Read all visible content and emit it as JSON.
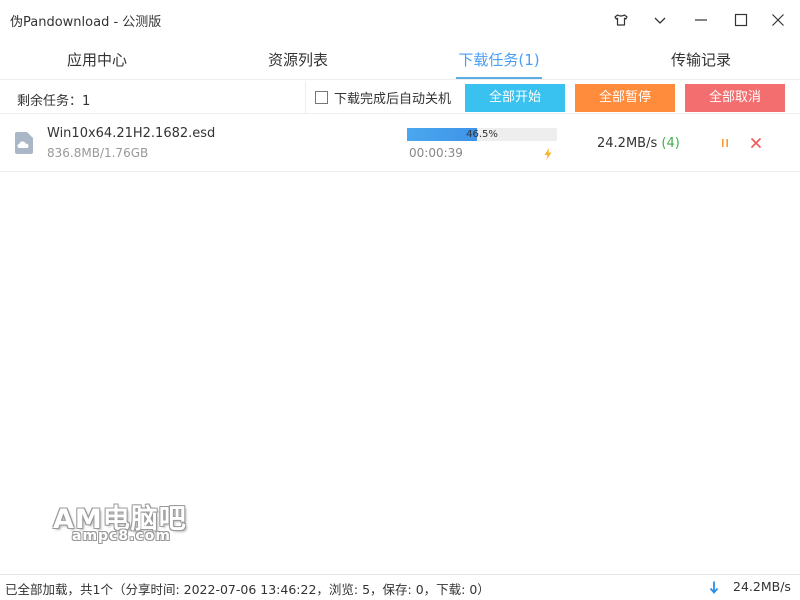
{
  "window": {
    "title": "伪Pandownload - 公测版",
    "icons": [
      "tshirt-icon",
      "chevron-down-icon",
      "minimize-icon",
      "maximize-icon",
      "close-icon"
    ]
  },
  "tabs": [
    {
      "label": "应用中心",
      "active": false
    },
    {
      "label": "资源列表",
      "active": false
    },
    {
      "label": "下载任务(1)",
      "active": true
    },
    {
      "label": "传输记录",
      "active": false
    }
  ],
  "toolbar": {
    "remaining": "剩余任务：1",
    "auto_shutdown_label": "下载完成后自动关机",
    "auto_shutdown_checked": false,
    "start_all": "全部开始",
    "pause_all": "全部暂停",
    "cancel_all": "全部取消"
  },
  "download": {
    "file_name": "Win10x64.21H2.1682.esd",
    "size": "836.8MB/1.76GB",
    "progress_label": "46.5%",
    "progress_fraction": 0.465,
    "elapsed": "00:00:39",
    "speed": "24.2MB/s",
    "connections": "(4)"
  },
  "watermark": {
    "big": "AM电脑吧",
    "small": "ampc8.com"
  },
  "status": {
    "text": "已全部加载，共1个（分享时间: 2022-07-06 13:46:22，浏览: 5，保存: 0，下载: 0）",
    "total_speed": "24.2MB/s"
  },
  "colors": {
    "accent": "#4a9ff5",
    "start": "#39c1f0",
    "pause": "#ff8c3c",
    "cancel": "#f36f6f",
    "connections": "#3fae49"
  }
}
